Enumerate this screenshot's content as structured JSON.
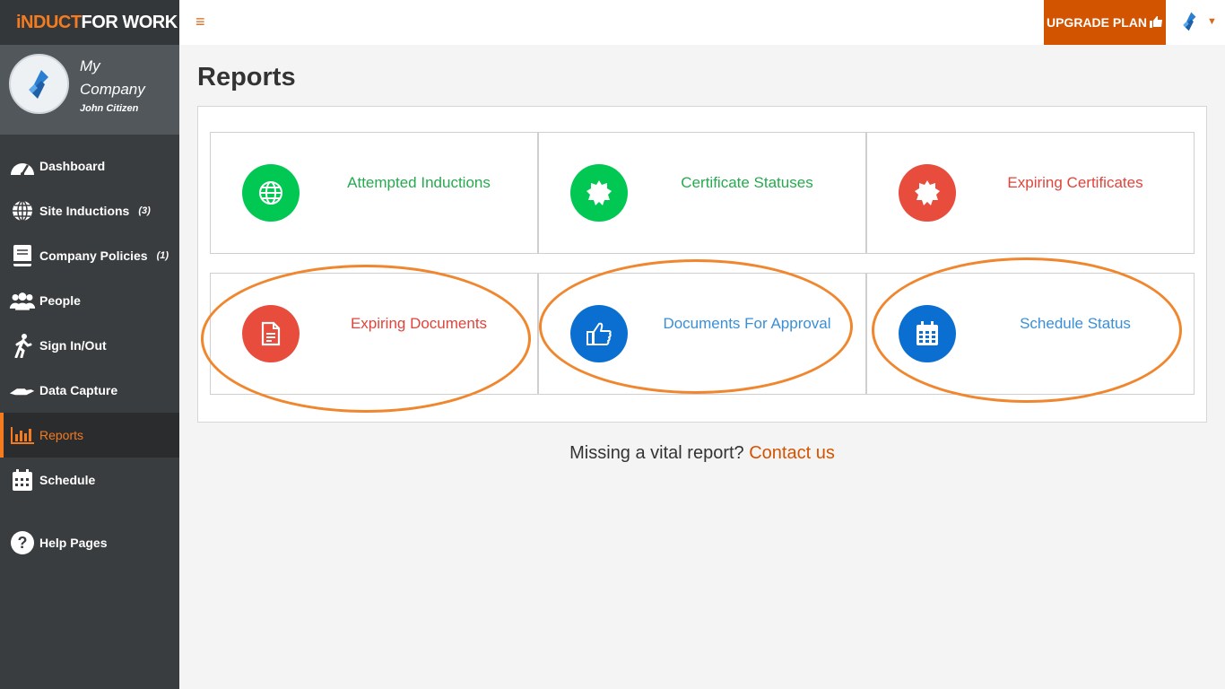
{
  "brand": {
    "part1": "iNDUCT",
    "part2": "FOR WORK"
  },
  "profile": {
    "company": "My Company",
    "user": "John Citizen"
  },
  "nav": [
    {
      "label": "Dashboard",
      "count": "",
      "icon": "dashboard-icon"
    },
    {
      "label": "Site Inductions",
      "count": "(3)",
      "icon": "globe-icon"
    },
    {
      "label": "Company Policies",
      "count": "(1)",
      "icon": "book-icon"
    },
    {
      "label": "People",
      "count": "",
      "icon": "people-icon"
    },
    {
      "label": "Sign In/Out",
      "count": "",
      "icon": "walking-icon"
    },
    {
      "label": "Data Capture",
      "count": "",
      "icon": "hand-icon"
    },
    {
      "label": "Reports",
      "count": "",
      "icon": "bar-chart-icon",
      "active": true
    },
    {
      "label": "Schedule",
      "count": "",
      "icon": "calendar-icon"
    },
    {
      "label": "Help Pages",
      "count": "",
      "icon": "question-icon"
    }
  ],
  "topbar": {
    "menu_icon": "≡",
    "upgrade_label": "UPGRADE PLAN"
  },
  "page": {
    "title": "Reports"
  },
  "colors": {
    "green": "#00c853",
    "green_text": "#27a94f",
    "red": "#e74c3c",
    "red_text": "#e0443c",
    "blue": "#0a6fd0",
    "blue_text": "#3a8fd6",
    "accent": "#d35400"
  },
  "cards": [
    {
      "label": "Attempted Inductions",
      "icon": "globe-icon",
      "color": "green"
    },
    {
      "label": "Certificate Statuses",
      "icon": "badge-icon",
      "color": "green"
    },
    {
      "label": "Expiring Certificates",
      "icon": "badge-icon",
      "color": "red"
    },
    {
      "label": "Expiring Documents",
      "icon": "document-icon",
      "color": "red"
    },
    {
      "label": "Documents For Approval",
      "icon": "thumbs-up-icon",
      "color": "blue"
    },
    {
      "label": "Schedule Status",
      "icon": "calendar-icon",
      "color": "blue"
    }
  ],
  "footer": {
    "question": "Missing a vital report?",
    "link": "Contact us"
  }
}
